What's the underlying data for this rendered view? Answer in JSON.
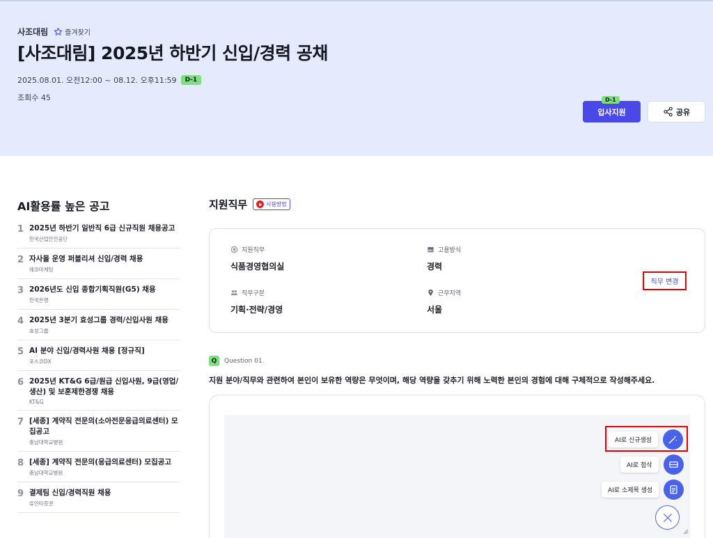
{
  "header": {
    "company": "사조대림",
    "favorite_label": "즐겨찾기",
    "title": "[사조대림] 2025년 하반기 신입/경력 공채",
    "period": "2025.08.01. 오전12:00 ~ 08.12. 오후11:59",
    "dday": "D-1",
    "views": "조회수 45",
    "apply_label": "입사지원",
    "apply_badge": "D-1",
    "share_label": "공유"
  },
  "sidebar": {
    "title": "AI활용률 높은 공고",
    "items": [
      {
        "num": "1",
        "title": "2025년 하반기 일반직 6급 신규직원 채용공고",
        "company": "한국산업안전공단"
      },
      {
        "num": "2",
        "title": "자사몰 운영 퍼블리셔 신입/경력 채용",
        "company": "에코마케팅"
      },
      {
        "num": "3",
        "title": "2026년도 신입 종합기획직원(G5) 채용",
        "company": "한국은행"
      },
      {
        "num": "4",
        "title": "2025년 3분기 효성그룹 경력/신입사원 채용",
        "company": "효성그룹"
      },
      {
        "num": "5",
        "title": "AI 분야 신입/경력사원 채용 [정규직]",
        "company": "포스코DX"
      },
      {
        "num": "6",
        "title": "2025년 KT&G 6급/원급 신입사원, 9급(영업/생산) 및 보훈제한경쟁 채용",
        "company": "KT&G"
      },
      {
        "num": "7",
        "title": "[세종] 계약직 전문의(소아전문응급의료센터) 모집공고",
        "company": "충남대학교병원"
      },
      {
        "num": "8",
        "title": "[세종] 계약직 전문의(응급의료센터) 모집공고",
        "company": "충남대학교병원"
      },
      {
        "num": "9",
        "title": "결제팀 신입/경력직원 채용",
        "company": "유안타증권"
      }
    ]
  },
  "job": {
    "section_title": "지원직무",
    "howto_label": "사용방법",
    "fields": {
      "role_label": "지원직무",
      "role_value": "식품경영협의실",
      "employment_label": "고용방식",
      "employment_value": "경력",
      "category_label": "직무구분",
      "category_value": "기획·전략/경영",
      "location_label": "근무지역",
      "location_value": "서울"
    },
    "change_label": "직무 변경"
  },
  "question": {
    "badge": "Q",
    "label": "Question 01.",
    "text": "지원 분야/직무와 관련하여 본인이 보유한 역량은 무엇이며, 해당 역량을 갖추기 위해 노력한 본인의 경험에 대해 구체적으로 작성해주세요."
  },
  "ai_actions": {
    "generate": "AI로 신규생성",
    "correct": "AI로 첨삭",
    "subtitle": "AI로 소제목 생성"
  },
  "colors": {
    "hero_bg": "#e4ebfd",
    "accent": "#4a49e8",
    "dday_green": "#7ce07e",
    "highlight_red": "#e00000"
  }
}
